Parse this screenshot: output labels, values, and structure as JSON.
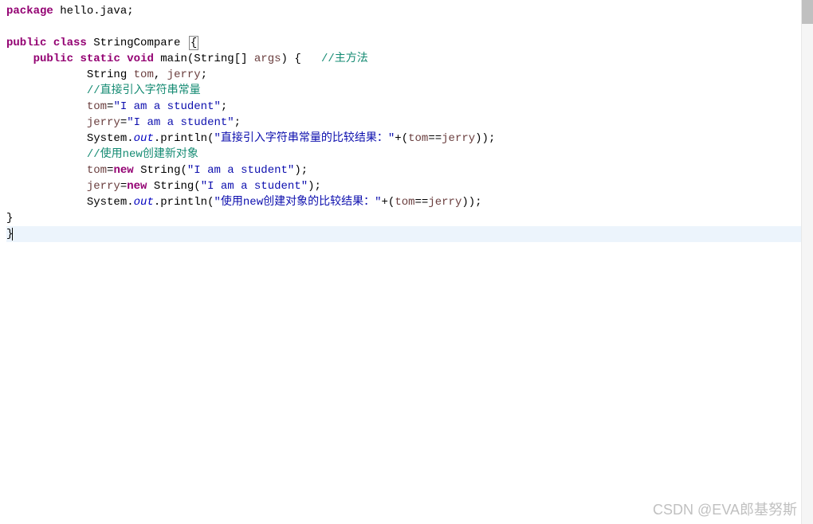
{
  "code": {
    "line1_kw1": "package",
    "line1_rest": " hello.java;",
    "line3_kw1": "public",
    "line3_kw2": "class",
    "line3_classname": " StringCompare ",
    "line4_indent": "    ",
    "line4_kw1": "public",
    "line4_kw2": "static",
    "line4_kw3": "void",
    "line4_method": " main",
    "line4_params_open": "(String[] ",
    "line4_param_name": "args",
    "line4_params_close": ") {   ",
    "line4_comment": "//主方法",
    "line5_indent": "            ",
    "line5_type": "String ",
    "line5_var1": "tom",
    "line5_comma": ", ",
    "line5_var2": "jerry",
    "line5_semi": ";",
    "line6_indent": "            ",
    "line6_comment": "//直接引入字符串常量",
    "line7_indent": "            ",
    "line7_var": "tom",
    "line7_assign": "=",
    "line7_str": "\"I am a student\"",
    "line7_semi": ";",
    "line8_indent": "            ",
    "line8_var": "jerry",
    "line8_assign": "=",
    "line8_str": "\"I am a student\"",
    "line8_semi": ";",
    "line9_indent": "            ",
    "line9_sys": "System.",
    "line9_out": "out",
    "line9_dot": ".println(",
    "line9_str": "\"直接引入字符串常量的比较结果：\"",
    "line9_plus": "+(",
    "line9_var1": "tom",
    "line9_eq": "==",
    "line9_var2": "jerry",
    "line9_close": "));",
    "line10_indent": "            ",
    "line10_comment": "//使用new创建新对象",
    "line11_indent": "            ",
    "line11_var": "tom",
    "line11_assign": "=",
    "line11_kw": "new",
    "line11_type": " String(",
    "line11_str": "\"I am a student\"",
    "line11_close": ");",
    "line12_indent": "            ",
    "line12_var": "jerry",
    "line12_assign": "=",
    "line12_kw": "new",
    "line12_type": " String(",
    "line12_str": "\"I am a student\"",
    "line12_close": ");",
    "line13_indent": "            ",
    "line13_sys": "System.",
    "line13_out": "out",
    "line13_dot": ".println(",
    "line13_str": "\"使用new创建对象的比较结果：\"",
    "line13_plus": "+(",
    "line13_var1": "tom",
    "line13_eq": "==",
    "line13_var2": "jerry",
    "line13_close": "));",
    "line14": "}",
    "line15": "}",
    "open_brace_box": "{"
  },
  "watermark": "CSDN @EVA郎基努斯"
}
